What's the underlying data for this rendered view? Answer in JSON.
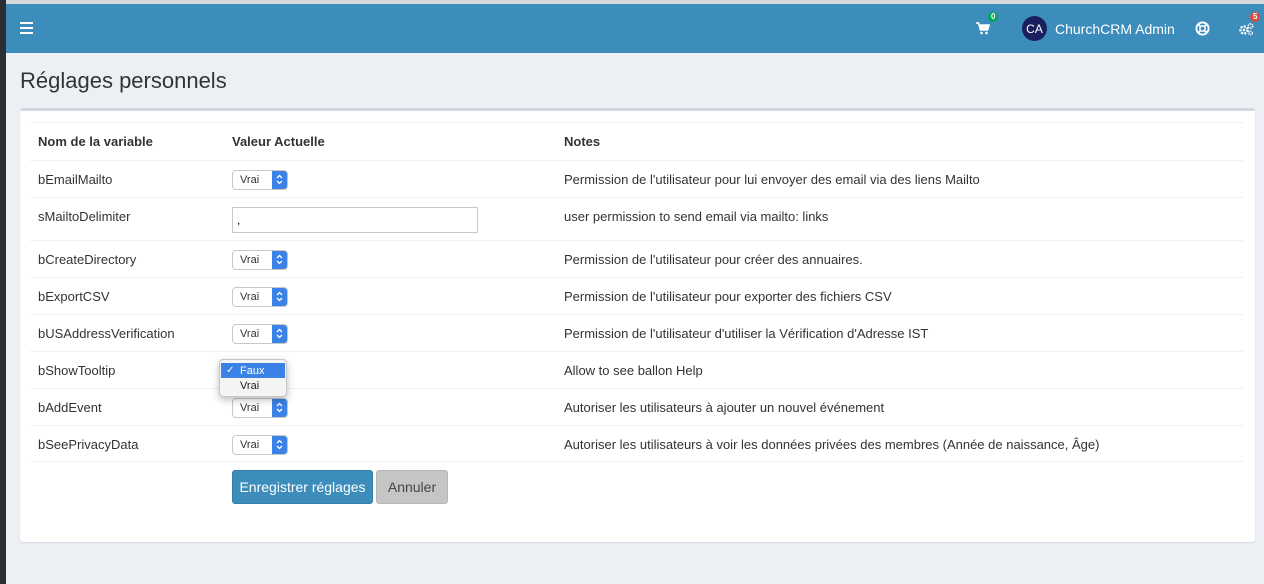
{
  "header": {
    "cart_count": "0",
    "user_initials": "CA",
    "user_name": "ChurchCRM Admin",
    "settings_count": "5"
  },
  "page": {
    "title": "Réglages personnels"
  },
  "table": {
    "columns": [
      "Nom de la variable",
      "Valeur Actuelle",
      "Notes"
    ],
    "rows": [
      {
        "name": "bEmailMailto",
        "value": "Vrai",
        "type": "select",
        "note": "Permission de l'utilisateur pour lui envoyer des email via des liens Mailto"
      },
      {
        "name": "sMailtoDelimiter",
        "value": ",",
        "type": "text",
        "note": "user permission to send email via mailto: links"
      },
      {
        "name": "bCreateDirectory",
        "value": "Vrai",
        "type": "select",
        "note": "Permission de l'utilisateur pour créer des annuaires."
      },
      {
        "name": "bExportCSV",
        "value": "Vrai",
        "type": "select",
        "note": "Permission de l'utilisateur pour exporter des fichiers CSV"
      },
      {
        "name": "bUSAddressVerification",
        "value": "Vrai",
        "type": "select",
        "note": "Permission de l'utilisateur d'utiliser la Vérification d'Adresse IST"
      },
      {
        "name": "bShowTooltip",
        "value": "Faux",
        "type": "select-open",
        "note": "Allow to see ballon Help"
      },
      {
        "name": "bAddEvent",
        "value": "Vrai",
        "type": "select",
        "note": "Autoriser les utilisateurs à ajouter un nouvel événement"
      },
      {
        "name": "bSeePrivacyData",
        "value": "Vrai",
        "type": "select",
        "note": "Autoriser les utilisateurs à voir les données privées des membres (Année de naissance, Âge)"
      }
    ]
  },
  "dropdown": {
    "options": [
      "Faux",
      "Vrai"
    ],
    "selected": "Faux",
    "check": "✓"
  },
  "buttons": {
    "save": "Enregistrer réglages",
    "cancel": "Annuler"
  },
  "colors": {
    "header": "#3c8dbc",
    "select_accent": "#3b82e6"
  }
}
